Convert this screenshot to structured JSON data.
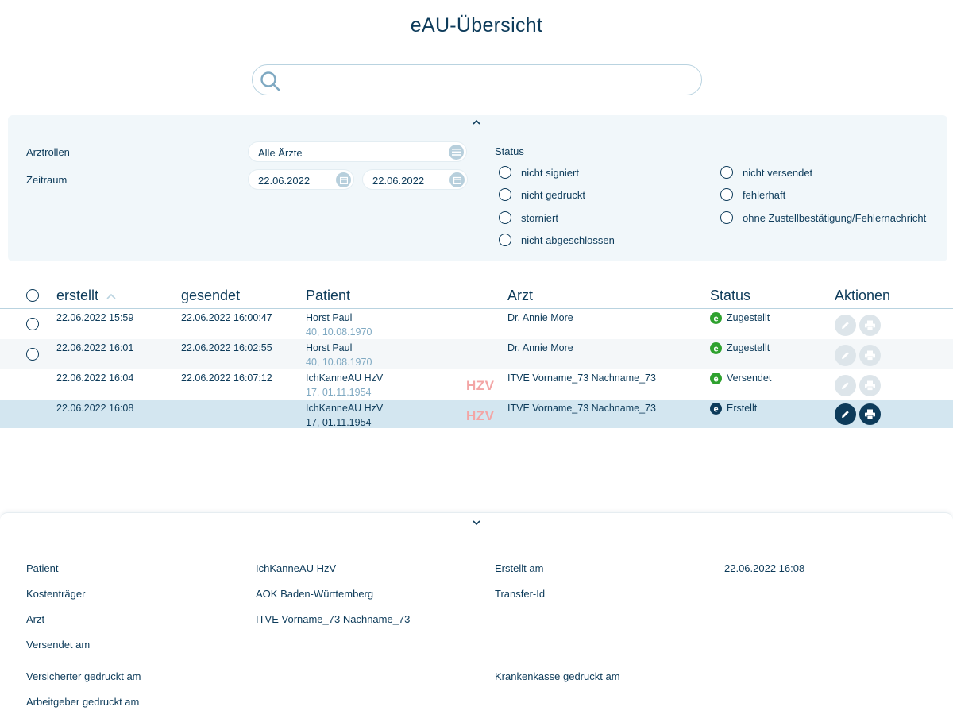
{
  "title": "eAU-Übersicht",
  "search": {
    "value": "",
    "placeholder": ""
  },
  "filters": {
    "arztrollen_label": "Arztrollen",
    "arztrollen_value": "Alle Ärzte",
    "zeitraum_label": "Zeitraum",
    "date_from": "22.06.2022",
    "date_to": "22.06.2022",
    "status_label": "Status",
    "status_options": [
      "nicht signiert",
      "nicht gedruckt",
      "storniert",
      "nicht abgeschlossen",
      "nicht versendet",
      "fehlerhaft",
      "ohne Zustellbestätigung/Fehlernachricht"
    ]
  },
  "table": {
    "headers": {
      "erstellt": "erstellt",
      "gesendet": "gesendet",
      "patient": "Patient",
      "arzt": "Arzt",
      "status": "Status",
      "aktionen": "Aktionen"
    },
    "rows": [
      {
        "erstellt": "22.06.2022 15:59",
        "gesendet": "22.06.2022 16:00:47",
        "patient_name": "Horst Paul",
        "patient_info": "40, 10.08.1970",
        "hzv": "",
        "arzt": "Dr. Annie More",
        "status": "Zugestellt",
        "status_color": "#2ea12e"
      },
      {
        "erstellt": "22.06.2022 16:01",
        "gesendet": "22.06.2022 16:02:55",
        "patient_name": "Horst Paul",
        "patient_info": "40, 10.08.1970",
        "hzv": "",
        "arzt": "Dr. Annie More",
        "status": "Zugestellt",
        "status_color": "#2ea12e"
      },
      {
        "erstellt": "22.06.2022 16:04",
        "gesendet": "22.06.2022 16:07:12",
        "patient_name": "IchKanneAU HzV",
        "patient_info": "17, 01.11.1954",
        "hzv": "HZV",
        "arzt": "ITVE Vorname_73 Nachname_73",
        "status": "Versendet",
        "status_color": "#2ea12e"
      },
      {
        "erstellt": "22.06.2022 16:08",
        "gesendet": "",
        "patient_name": "IchKanneAU HzV",
        "patient_info": "17, 01.11.1954",
        "hzv": "HZV",
        "arzt": "ITVE Vorname_73 Nachname_73",
        "status": "Erstellt",
        "status_color": "#0d3b5a"
      }
    ]
  },
  "details": {
    "patient_label": "Patient",
    "patient_value": "IchKanneAU HzV",
    "kostentraeger_label": "Kostenträger",
    "kostentraeger_value": "AOK Baden-Württemberg",
    "arzt_label": "Arzt",
    "arzt_value": "ITVE Vorname_73 Nachname_73",
    "versendet_label": "Versendet am",
    "versichert_label": "Versicherter gedruckt am",
    "arbeitgeber_label": "Arbeitgeber gedruckt am",
    "erstellt_label": "Erstellt am",
    "erstellt_value": "22.06.2022 16:08",
    "transfer_label": "Transfer-Id",
    "krankenkasse_label": "Krankenkasse gedruckt am"
  },
  "colors": {
    "primary": "#0d3b5a",
    "accent_light": "#7fa9c2",
    "success": "#2ea12e",
    "hzv": "#f3a5a5",
    "selected_row": "#d3e6f0",
    "panel_bg": "#f1f7fa"
  },
  "icons": [
    "search-icon",
    "chevron-up-icon",
    "chevron-down-icon",
    "list-icon",
    "calendar-icon",
    "edit-icon",
    "print-icon",
    "e-status-icon",
    "sort-asc-icon"
  ]
}
